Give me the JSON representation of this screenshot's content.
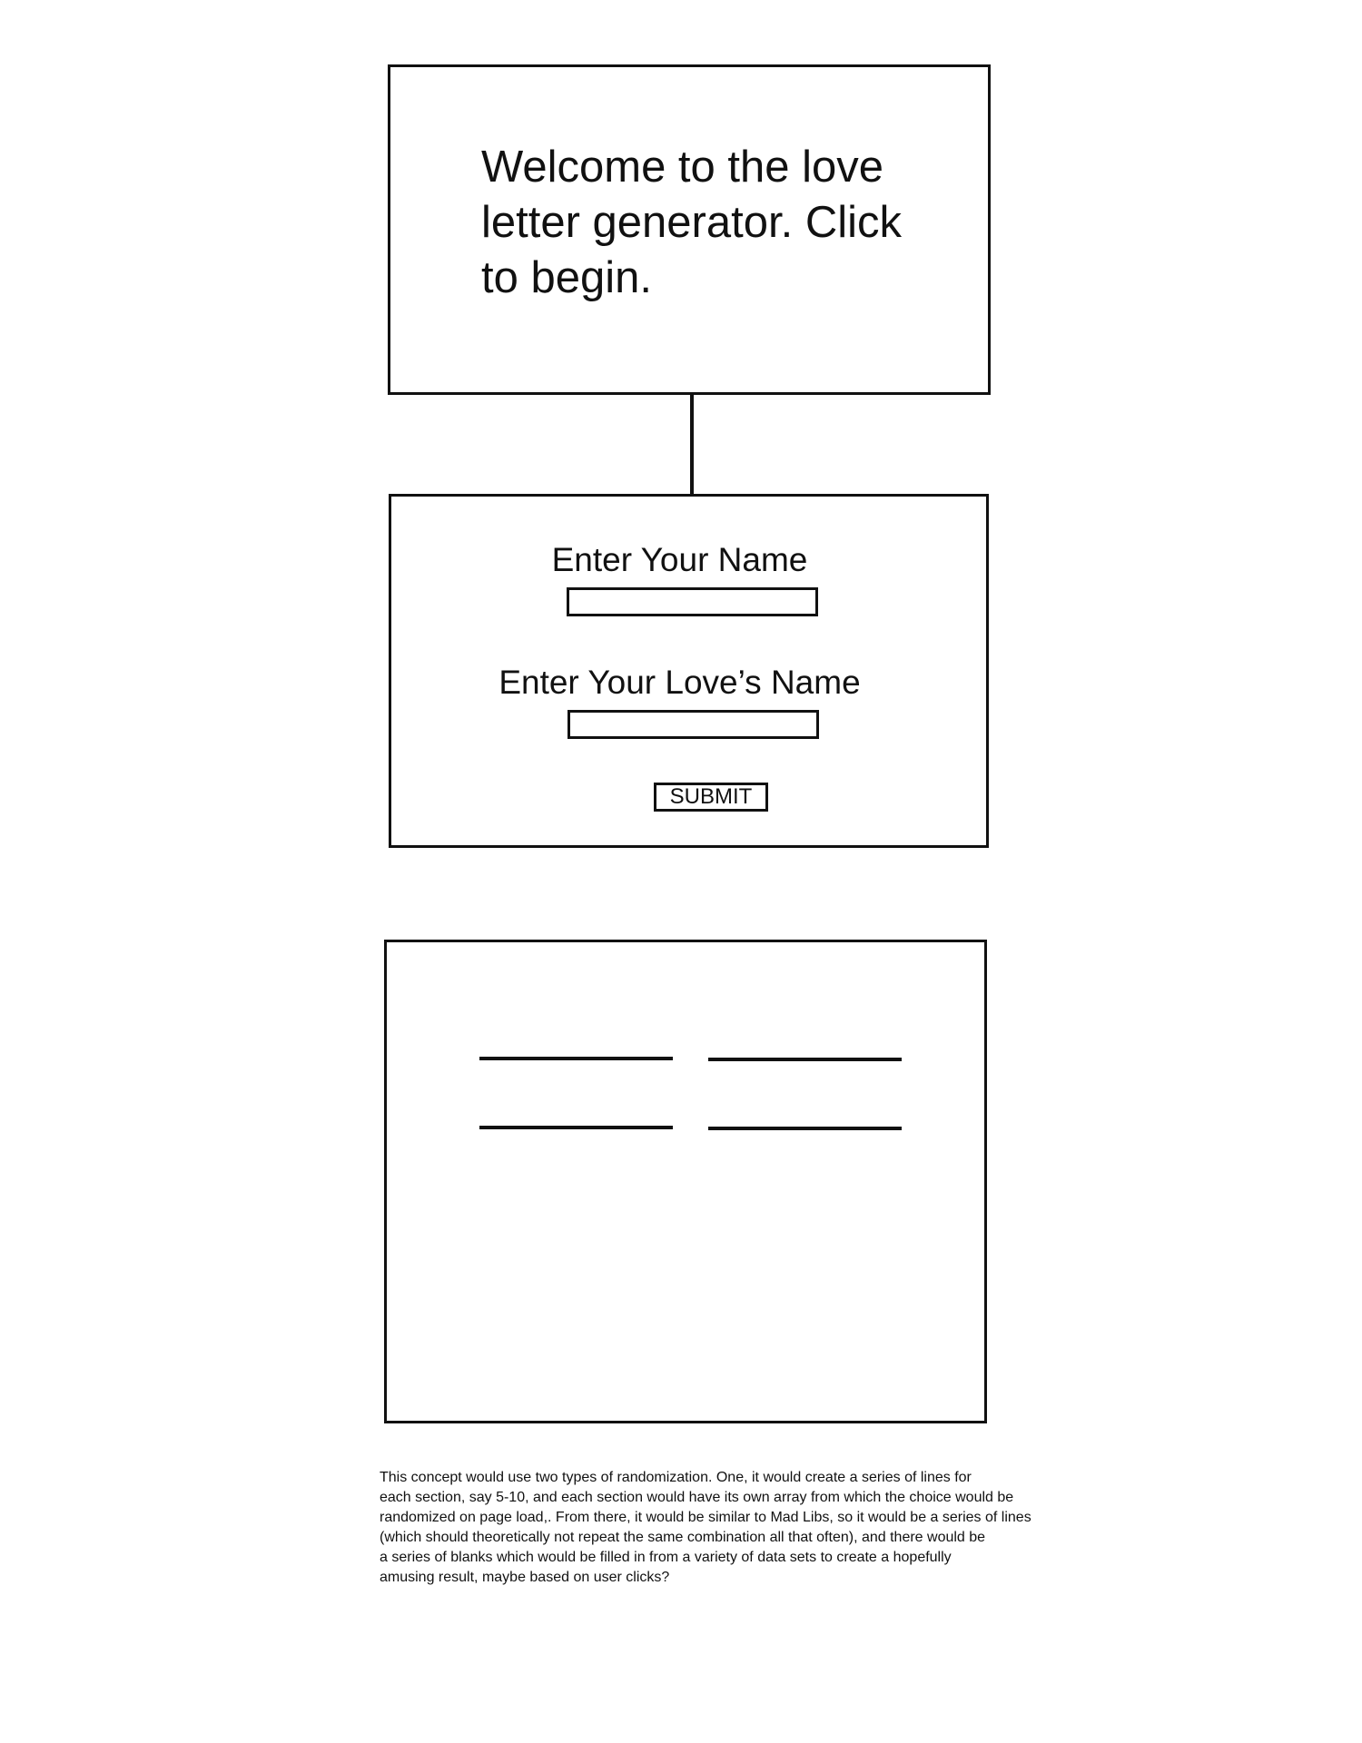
{
  "welcome": {
    "text": "Welcome to the love\nletter generator. Click\nto begin."
  },
  "form": {
    "your_name_label": "Enter Your Name",
    "your_name_value": "",
    "love_name_label": "Enter Your Love’s Name",
    "love_name_value": "",
    "submit_label": "SUBMIT"
  },
  "output": {
    "blank_count": 4
  },
  "note": {
    "text": "This concept would use two types of randomization.  One, it would create a series of lines for\neach section, say 5-10, and each section would have its own array from which the choice would be\nrandomized on page load,.  From there, it would be similar to Mad Libs, so it would be a series of lines\n(which should theoretically not repeat the same combination all that often), and there would be\na series of blanks which would be filled in from a variety of data sets to create a hopefully\namusing result, maybe based on user clicks?"
  }
}
